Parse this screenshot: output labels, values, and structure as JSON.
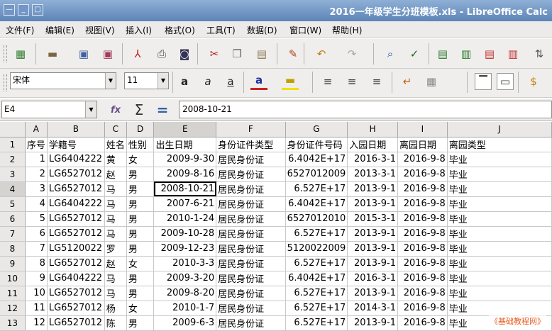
{
  "window": {
    "title": "2016一年级学生分班模板.xls - LibreOffice Calc",
    "minimize": "_",
    "maximize": "□",
    "restore": "—"
  },
  "menus": [
    "文件(F)",
    "编辑(E)",
    "视图(V)",
    "插入(I)",
    "格式(O)",
    "工具(T)",
    "数据(D)",
    "窗口(W)",
    "帮助(H)"
  ],
  "format": {
    "font_name": "宋体",
    "font_size": "11"
  },
  "formula_bar": {
    "cell_ref": "E4",
    "content": "2008-10-21",
    "function_label": "fx",
    "sum_label": "Σ",
    "equals_label": "="
  },
  "sheet": {
    "columns": [
      "A",
      "B",
      "C",
      "D",
      "E",
      "F",
      "G",
      "H",
      "I",
      "J"
    ],
    "selected_column": "E",
    "selected_row": "4",
    "active_cell": "E4",
    "rows": [
      {
        "num": "1",
        "cells": [
          "序号",
          "学籍号",
          "姓名",
          "性别",
          "出生日期",
          "身份证件类型",
          "身份证件号码",
          "入园日期",
          "离园日期",
          "离园类型"
        ]
      },
      {
        "num": "2",
        "cells": [
          "1",
          "LG6404222",
          "黄",
          "女",
          "2009-9-30",
          "居民身份证",
          "6.4042E+17",
          "2016-3-1",
          "2016-9-8",
          "毕业"
        ]
      },
      {
        "num": "3",
        "cells": [
          "2",
          "LG6527012",
          "赵",
          "男",
          "2009-8-16",
          "居民身份证",
          "6527012009",
          "2013-3-1",
          "2016-9-8",
          "毕业"
        ]
      },
      {
        "num": "4",
        "cells": [
          "3",
          "LG6527012",
          "马",
          "男",
          "2008-10-21",
          "居民身份证",
          "6.527E+17",
          "2013-9-1",
          "2016-9-8",
          "毕业"
        ]
      },
      {
        "num": "5",
        "cells": [
          "4",
          "LG6404222",
          "马",
          "男",
          "2007-6-21",
          "居民身份证",
          "6.4042E+17",
          "2013-9-1",
          "2016-9-8",
          "毕业"
        ]
      },
      {
        "num": "6",
        "cells": [
          "5",
          "LG6527012",
          "马",
          "男",
          "2010-1-24",
          "居民身份证",
          "6527012010",
          "2015-3-1",
          "2016-9-8",
          "毕业"
        ]
      },
      {
        "num": "7",
        "cells": [
          "6",
          "LG6527012",
          "马",
          "男",
          "2009-10-28",
          "居民身份证",
          "6.527E+17",
          "2013-9-1",
          "2016-9-8",
          "毕业"
        ]
      },
      {
        "num": "8",
        "cells": [
          "7",
          "LG5120022",
          "罗",
          "男",
          "2009-12-23",
          "居民身份证",
          "5120022009",
          "2013-9-1",
          "2016-9-8",
          "毕业"
        ]
      },
      {
        "num": "9",
        "cells": [
          "8",
          "LG6527012",
          "赵",
          "女",
          "2010-3-3",
          "居民身份证",
          "6.527E+17",
          "2013-9-1",
          "2016-9-8",
          "毕业"
        ]
      },
      {
        "num": "10",
        "cells": [
          "9",
          "LG6404222",
          "马",
          "男",
          "2009-3-20",
          "居民身份证",
          "6.4042E+17",
          "2016-3-1",
          "2016-9-8",
          "毕业"
        ]
      },
      {
        "num": "11",
        "cells": [
          "10",
          "LG6527012",
          "马",
          "男",
          "2009-8-20",
          "居民身份证",
          "6.527E+17",
          "2013-9-1",
          "2016-9-8",
          "毕业"
        ]
      },
      {
        "num": "12",
        "cells": [
          "11",
          "LG6527012",
          "杨",
          "女",
          "2010-1-7",
          "居民身份证",
          "6.527E+17",
          "2014-3-1",
          "2016-9-8",
          "毕业"
        ]
      },
      {
        "num": "13",
        "cells": [
          "12",
          "LG6527012",
          "陈",
          "男",
          "2009-6-3",
          "居民身份证",
          "6.527E+17",
          "2013-9-1",
          "2016-9-8",
          "毕业"
        ]
      }
    ]
  },
  "watermark": "《基础教程网》",
  "icons": {
    "toolbar1": [
      "new-document-icon",
      "open-icon",
      "save-icon",
      "save-as-icon",
      "export-pdf-icon",
      "print-icon",
      "print-preview-icon",
      "cut-icon",
      "copy-icon",
      "paste-icon",
      "clone-format-icon",
      "undo-icon",
      "redo-icon",
      "find-replace-icon",
      "spellcheck-icon",
      "insert-row-icon",
      "insert-column-icon",
      "delete-row-icon",
      "delete-column-icon",
      "sort-icon"
    ],
    "toolbar2": [
      "bold-icon",
      "italic-icon",
      "underline-icon",
      "font-color-icon",
      "highlight-icon",
      "align-left-icon",
      "align-center-icon",
      "align-right-icon",
      "wrap-text-icon",
      "merge-cells-icon",
      "align-top-icon",
      "align-center-vertical-icon",
      "currency-icon"
    ]
  }
}
